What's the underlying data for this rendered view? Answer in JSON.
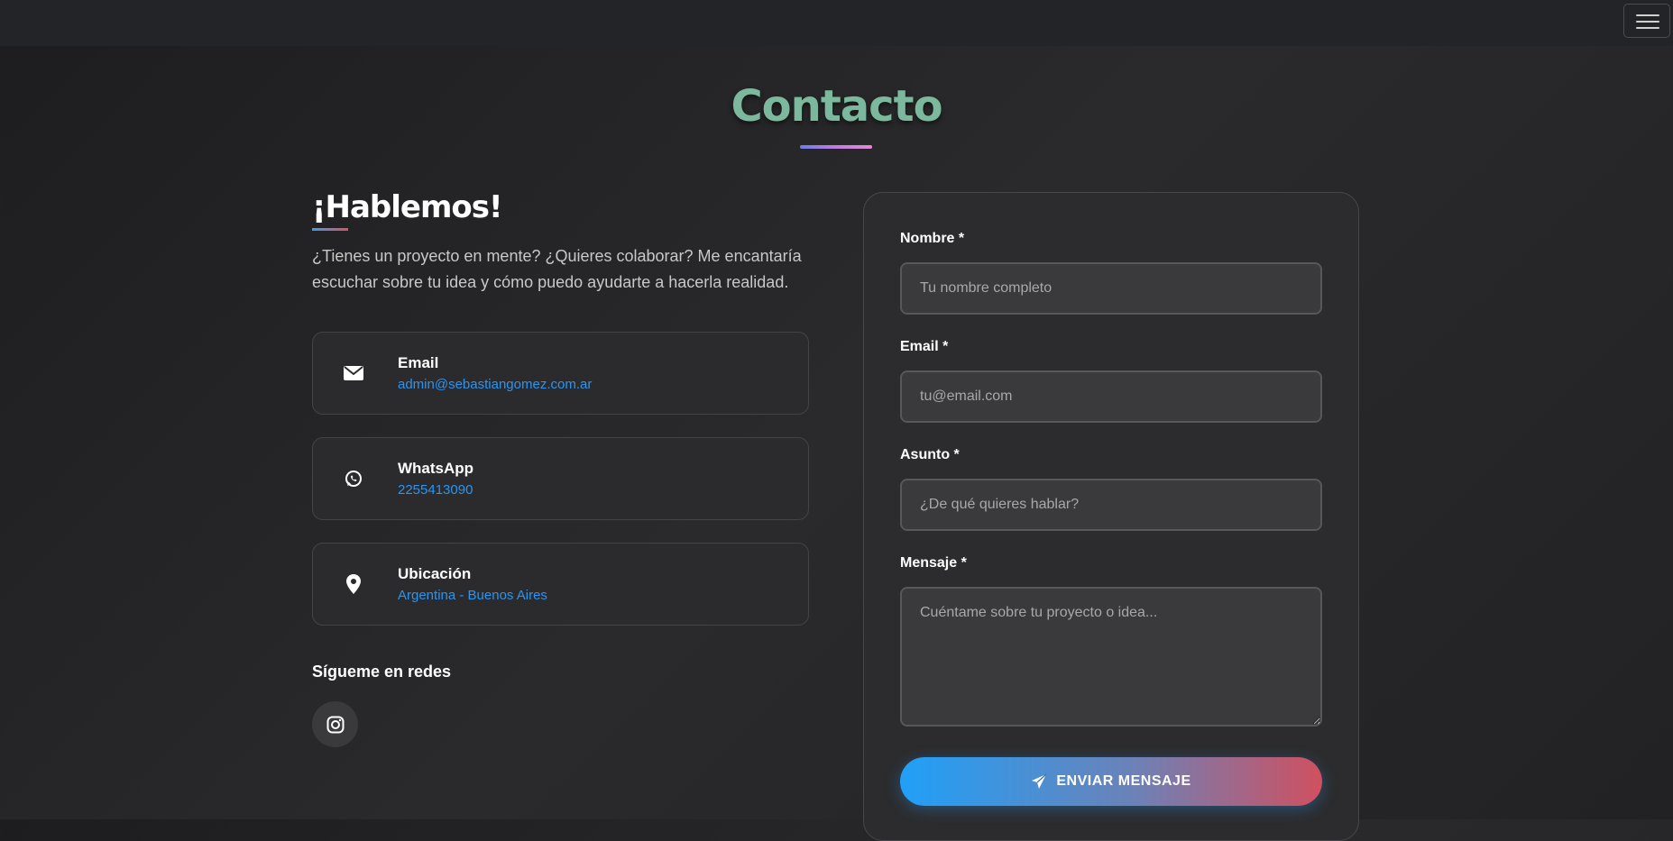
{
  "header": {
    "menu_icon": "hamburger-icon"
  },
  "section": {
    "title": "Contacto"
  },
  "intro": {
    "heading": "¡Hablemos!",
    "text": "¿Tienes un proyecto en mente? ¿Quieres colaborar? Me encantaría escuchar sobre tu idea y cómo puedo ayudarte a hacerla realidad."
  },
  "contact_cards": [
    {
      "icon": "envelope-icon",
      "label": "Email",
      "value": "admin@sebastiangomez.com.ar"
    },
    {
      "icon": "whatsapp-icon",
      "label": "WhatsApp",
      "value": "2255413090"
    },
    {
      "icon": "location-pin-icon",
      "label": "Ubicación",
      "value": "Argentina - Buenos Aires"
    }
  ],
  "social": {
    "title": "Sígueme en redes",
    "icon": "instagram-icon"
  },
  "form": {
    "name_label": "Nombre *",
    "name_placeholder": "Tu nombre completo",
    "email_label": "Email *",
    "email_placeholder": "tu@email.com",
    "subject_label": "Asunto *",
    "subject_placeholder": "¿De qué quieres hablar?",
    "message_label": "Mensaje *",
    "message_placeholder": "Cuéntame sobre tu proyecto o idea...",
    "submit_label": "ENVIAR MENSAJE",
    "submit_icon": "paper-plane-icon"
  },
  "colors": {
    "title": "#7bb89e",
    "link": "#2b95f0",
    "button_start": "#20a0f8",
    "button_end": "#d05060"
  }
}
